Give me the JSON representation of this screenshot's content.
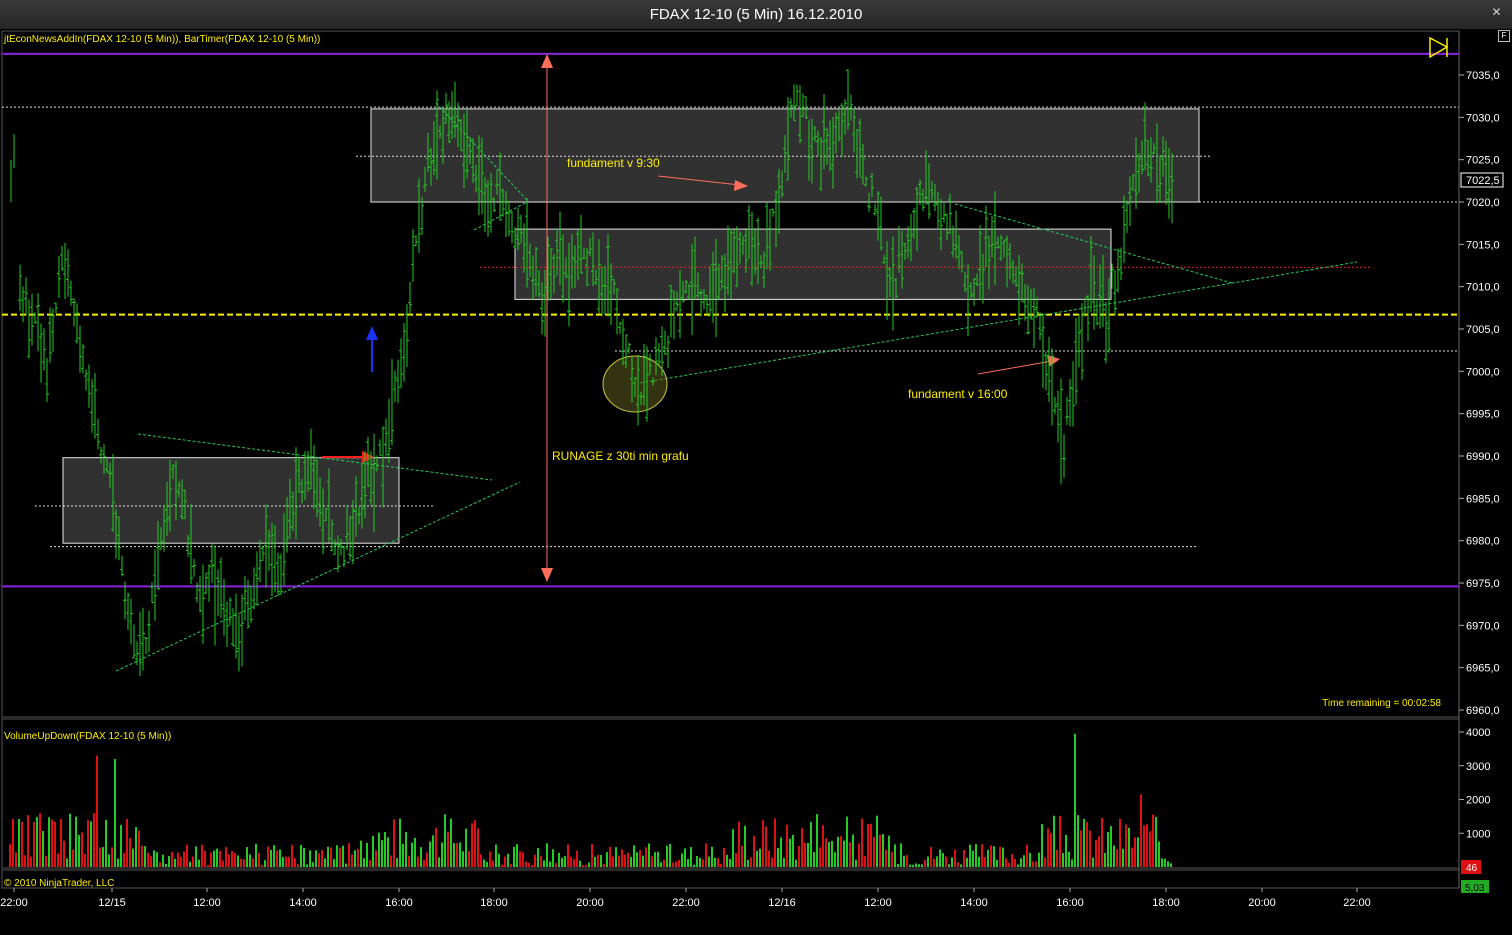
{
  "window": {
    "title": "FDAX 12-10 (5 Min)  16.12.2010"
  },
  "panels": {
    "price_indicators": "jtEconNewsAddIn(FDAX 12-10 (5 Min)), BarTimer(FDAX 12-10 (5 Min))",
    "volume_indicator": "VolumeUpDown(FDAX 12-10 (5 Min))",
    "copyright": "© 2010 NinjaTrader, LLC",
    "time_remaining": "Time remaining = 00:02:58",
    "current_price": "7022,5",
    "last_volume": "46",
    "mini_value": "5,03"
  },
  "annotations": {
    "fundament_930": "fundament v 9:30",
    "fundament_1600": "fundament v 16:00",
    "runage": "RUNAGE z 30ti min grafu"
  },
  "colors": {
    "up": "#22cc22",
    "down": "#dd1111",
    "zone_fill": "#3a3a3a",
    "level_purple": "#8822dd",
    "level_yellow": "#ffee00",
    "accent_arrow": "#ff6e5a"
  },
  "chart_data": [
    {
      "type": "bar",
      "title": "FDAX 12-10 (5 Min)",
      "subtype": "ohlc",
      "y_ticks": [
        "7035,0",
        "7030,0",
        "7025,0",
        "7020,0",
        "7015,0",
        "7010,0",
        "7005,0",
        "7000,0",
        "6995,0",
        "6990,0",
        "6985,0",
        "6980,0",
        "6975,0",
        "6970,0",
        "6965,0",
        "6960,0"
      ],
      "ylim": [
        6958,
        7040
      ],
      "x_ticks": [
        "22:00",
        "12/15",
        "12:00",
        "14:00",
        "16:00",
        "18:00",
        "20:00",
        "22:00",
        "12/16",
        "12:00",
        "14:00",
        "16:00",
        "18:00",
        "20:00",
        "22:00"
      ],
      "key_levels": {
        "purple_high": 7037.5,
        "purple_low": 6974.6,
        "yellow_dashed": 7006.7,
        "red_dotted": 7012.3
      },
      "zones": [
        {
          "from": 7020,
          "to": 7031
        },
        {
          "from": 7008.5,
          "to": 7016.8
        },
        {
          "from": 6979.7,
          "to": 6989.8
        }
      ],
      "session_1_anchor_points": [
        7022,
        7028,
        7009,
        7006,
        7000,
        7012,
        7008,
        6998,
        6990,
        6982,
        6970,
        6966,
        6978,
        6988,
        6983,
        6972,
        6976,
        6971,
        6969,
        6975,
        6979,
        6977,
        6986,
        6988,
        6984,
        6979,
        6981,
        6986,
        6989,
        6995,
        7004,
        7019,
        7027,
        7030,
        7028,
        7024,
        7019,
        7021,
        7016,
        7014,
        7009,
        7013,
        7011,
        7015,
        7010,
        7009,
        7002,
        6998,
        7000,
        7003,
        7009,
        7011,
        7008,
        7012,
        7013,
        7016,
        7012
      ],
      "session_2_anchor_points": [
        7016,
        7020,
        7033,
        7029,
        7025,
        7027,
        7031,
        7024,
        7020,
        7008,
        7014,
        7018,
        7023,
        7018,
        7016,
        7008,
        7013,
        7017,
        7012,
        7009,
        7006,
        7000,
        6991,
        7002,
        7010,
        7007,
        7012,
        7022,
        7027,
        7024,
        7022
      ]
    },
    {
      "type": "bar",
      "title": "VolumeUpDown(FDAX 12-10 (5 Min))",
      "y_ticks": [
        "4000",
        "3000",
        "2000",
        "1000"
      ],
      "ylim": [
        0,
        4000
      ],
      "spikes": [
        {
          "time": "10:45",
          "value": 3300,
          "dir": "down"
        },
        {
          "time": "11:15",
          "value": 3200,
          "dir": "up"
        },
        {
          "time": "16:00",
          "value": 3500,
          "dir": "up"
        },
        {
          "time": "17:35",
          "value": 2300,
          "dir": "down"
        },
        {
          "time": "16:00 (12/16)",
          "value": 3950,
          "dir": "up"
        },
        {
          "time": "17:20 (12/16)",
          "value": 2150,
          "dir": "down"
        }
      ],
      "last_value": 46
    }
  ]
}
